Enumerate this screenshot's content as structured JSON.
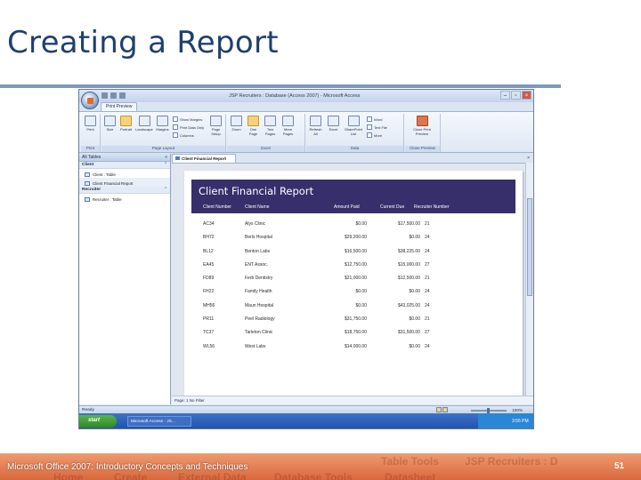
{
  "slide": {
    "title": "Creating a Report",
    "footer": "Microsoft Office 2007: Introductory Concepts and Techniques",
    "page_number": "51",
    "footer_ghost": {
      "home": "Home",
      "create": "Create",
      "external": "External Data",
      "dbtools": "Database Tools",
      "datasheet": "Datasheet",
      "table_tools": "Table Tools",
      "recruiters": "JSP Recruiters : D"
    }
  },
  "window": {
    "title": "JSP Recruiters : Database (Access 2007) - Microsoft Access",
    "ribbon_tab": "Print Preview",
    "groups": {
      "print": "Print",
      "page_layout": "Page Layout",
      "zoom": "Zoom",
      "data": "Data",
      "close_preview": "Close Preview"
    },
    "buttons": {
      "print": "Print",
      "size": "Size",
      "portrait": "Portrait",
      "landscape": "Landscape",
      "margins": "Margins",
      "page_setup": "Page Setup",
      "zoom": "Zoom",
      "one_page": "One Page",
      "two_pages": "Two Pages",
      "more_pages": "More Pages",
      "refresh_all": "Refresh All",
      "excel": "Excel",
      "sharepoint": "SharePoint List",
      "close_preview": "Close Print Preview"
    },
    "small": {
      "show_margins": "Show Margins",
      "print_data_only": "Print Data Only",
      "columns": "Columns",
      "word": "Word",
      "text_file": "Text File",
      "more": "More"
    },
    "nav": {
      "header": "All Tables",
      "groups": [
        {
          "name": "Client",
          "items": [
            "Client : Table",
            "Client Financial Report"
          ]
        },
        {
          "name": "Recruiter",
          "items": [
            "Recruiter : Table"
          ]
        }
      ]
    },
    "doc_tab": "Client Financial Report",
    "status": "Ready",
    "zoom_level": "100%",
    "record_nav": "Page:  1   No Filter",
    "taskbar": {
      "start": "start",
      "app": "Microsoft Access - JS...",
      "clock": "3:55 PM"
    }
  },
  "report": {
    "title": "Client Financial Report",
    "columns": [
      "Client Number",
      "Client Name",
      "Amount Paid",
      "Current Due",
      "Recruiter Number"
    ],
    "rows": [
      [
        "AC34",
        "Alys Clinic",
        "$0.00",
        "$17,500.00",
        "21"
      ],
      [
        "BH72",
        "Berls Hospital",
        "$29,200.00",
        "$0.00",
        "24"
      ],
      [
        "BL12",
        "Benton Labs",
        "$16,500.00",
        "$38,225.00",
        "24"
      ],
      [
        "EA45",
        "ENT Assoc.",
        "$12,750.00",
        "$15,000.00",
        "27"
      ],
      [
        "FD89",
        "Ferb Dentistry",
        "$21,000.00",
        "$12,500.00",
        "21"
      ],
      [
        "FH22",
        "Family Health",
        "$0.00",
        "$0.00",
        "24"
      ],
      [
        "MH56",
        "Maun Hospital",
        "$0.00",
        "$43,025.00",
        "24"
      ],
      [
        "PR11",
        "Peel Radiology",
        "$31,750.00",
        "$0.00",
        "21"
      ],
      [
        "TC37",
        "Tarleton Clinic",
        "$18,750.00",
        "$31,500.00",
        "27"
      ],
      [
        "WL56",
        "West Labs",
        "$14,000.00",
        "$0.00",
        "24"
      ]
    ]
  }
}
